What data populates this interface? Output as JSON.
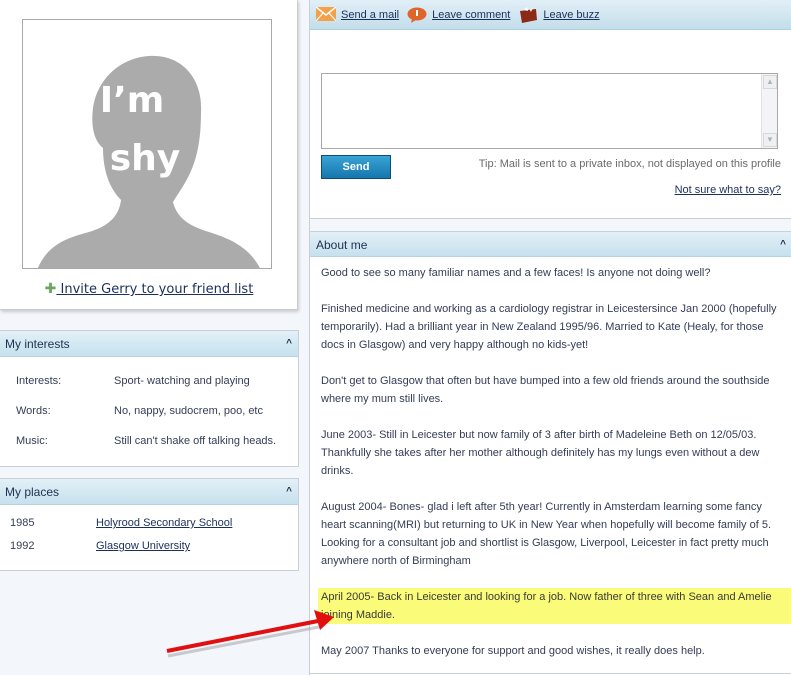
{
  "profile": {
    "photo_placeholder_text_line1": "I’m",
    "photo_placeholder_text_line2": "shy",
    "invite_label": " Invite Gerry to your friend list"
  },
  "interests": {
    "title": "My interests",
    "collapse_icon": "^",
    "rows": [
      {
        "label": "Interests:",
        "value": "Sport- watching and playing"
      },
      {
        "label": "Words:",
        "value": "No, nappy, sudocrem, poo, etc"
      },
      {
        "label": "Music:",
        "value": "Still can't shake off talking heads."
      }
    ]
  },
  "places": {
    "title": "My places",
    "collapse_icon": "^",
    "rows": [
      {
        "year": "1985",
        "name": "Holyrood Secondary School"
      },
      {
        "year": "1992",
        "name": "Glasgow University"
      }
    ]
  },
  "actions": {
    "send_mail": "Send a mail",
    "leave_comment": "Leave comment",
    "leave_buzz": "Leave buzz"
  },
  "mail": {
    "message_value": "",
    "send_label": "Send",
    "tip": "Tip: Mail is sent to a private inbox, not displayed on this profile",
    "help_link": "Not sure what to say?"
  },
  "about": {
    "title": "About me",
    "collapse_icon": "^",
    "paragraphs": [
      "Good to see so many familiar names and a few faces! Is anyone not doing well?",
      "Finished medicine and working as a cardiology registrar in Leicestersince Jan 2000 (hopefully temporarily). Had a brilliant year in New Zealand 1995/96. Married to Kate (Healy, for those docs in Glasgow) and very happy although no kids-yet!",
      "Don't get to Glasgow that often but have bumped into a few old friends around the southside where my mum still lives.",
      "June 2003- Still in Leicester but now family of 3 after birth of Madeleine Beth on 12/05/03. Thankfully she takes after her mother although definitely has my lungs even without a dew drinks.",
      "August 2004- Bones- glad i left after 5th year! Currently in Amsterdam learning some fancy heart scanning(MRI) but returning to UK in New Year when hopefully will become family of 5. Looking for a consultant job and shortlist is Glasgow, Liverpool, Leicester in fact pretty much anywhere north of Birmingham",
      "April 2005- Back in Leicester and looking for a job. Now father of three with Sean and Amelie joining Maddie.",
      "May 2007 Thanks to everyone for support and good wishes, it really does help."
    ],
    "highlighted_index": 5
  },
  "colors": {
    "highlight": "#fbfb7a",
    "annotation_arrow": "#e01010",
    "send_button": "#1d86bf"
  }
}
